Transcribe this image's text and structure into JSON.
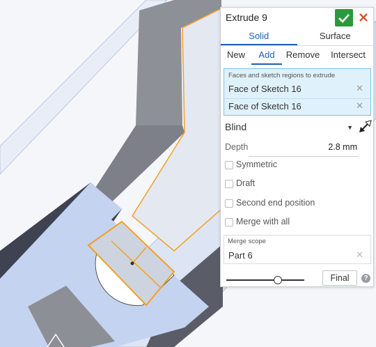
{
  "dialog": {
    "title": "Extrude 9",
    "ok_icon": "checkmark-icon",
    "cancel_icon": "close-icon",
    "tabs_type": [
      "Solid",
      "Surface"
    ],
    "tabs_operation": [
      "New",
      "Add",
      "Remove",
      "Intersect"
    ],
    "active_type": "Solid",
    "active_operation": "Add",
    "faces": {
      "label": "Faces and sketch regions to extrude",
      "items": [
        "Face of Sketch 16",
        "Face of Sketch 16"
      ]
    },
    "end_type": "Blind",
    "depth": {
      "label": "Depth",
      "value": "2.8 mm"
    },
    "checkboxes": [
      "Symmetric",
      "Draft",
      "Second end position",
      "Merge with all"
    ],
    "merge_scope": {
      "label": "Merge scope",
      "value": "Part 6"
    },
    "final_button": "Final",
    "help_glyph": "?"
  },
  "colors": {
    "accent": "#1d5fb8",
    "ok_green": "#2c9a3b",
    "cancel_red": "#d9532b",
    "selection_orange": "#f2a024",
    "faces_bg": "#dff1fb"
  }
}
